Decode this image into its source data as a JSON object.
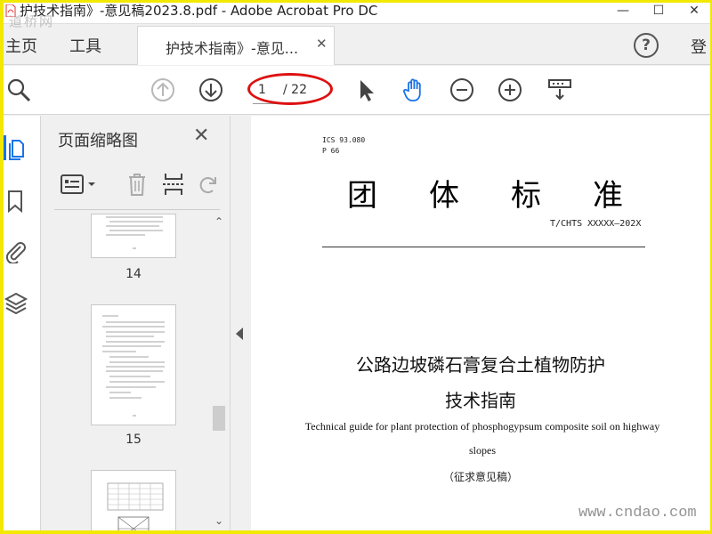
{
  "window": {
    "title": "护技术指南》-意见稿2023.8.pdf - Adobe Acrobat Pro DC",
    "minimize": "—",
    "maximize": "☐",
    "close": "✕"
  },
  "nav": {
    "home": "主页",
    "tools": "工具",
    "tab_label": "护技术指南》-意见...",
    "tab_close": "✕",
    "help": "?",
    "login": "登"
  },
  "toolbar": {
    "current_page": "1",
    "total_pages": "/ 22",
    "icons": [
      "search-zoom-icon",
      "page-up-icon",
      "page-down-icon",
      "select-arrow-icon",
      "hand-tool-icon",
      "zoom-out-icon",
      "zoom-in-icon",
      "page-display-icon"
    ]
  },
  "thumb_panel": {
    "title": "页面缩略图",
    "close": "✕",
    "thumbnails": [
      {
        "number": "14"
      },
      {
        "number": "15"
      },
      {
        "number": ""
      }
    ]
  },
  "document": {
    "ics": "ICS 93.080",
    "p": "P   66",
    "heading_chars": [
      "团",
      "体",
      "标",
      "准"
    ],
    "std_code": "T/CHTS XXXXX—202X",
    "title_line1": "公路边坡磷石膏复合土植物防护",
    "title_line2": "技术指南",
    "en_title": "Technical guide for plant protection of phosphogypsum composite soil on highway slopes",
    "draft_note": "（征求意见稿）"
  },
  "watermarks": {
    "top_left": "道桥网",
    "bottom_right": "www.cndao.com"
  },
  "colors": {
    "background_frame": "#f2e800",
    "annotation_red": "#dd1111",
    "hand_tool_blue": "#1a73e8"
  }
}
